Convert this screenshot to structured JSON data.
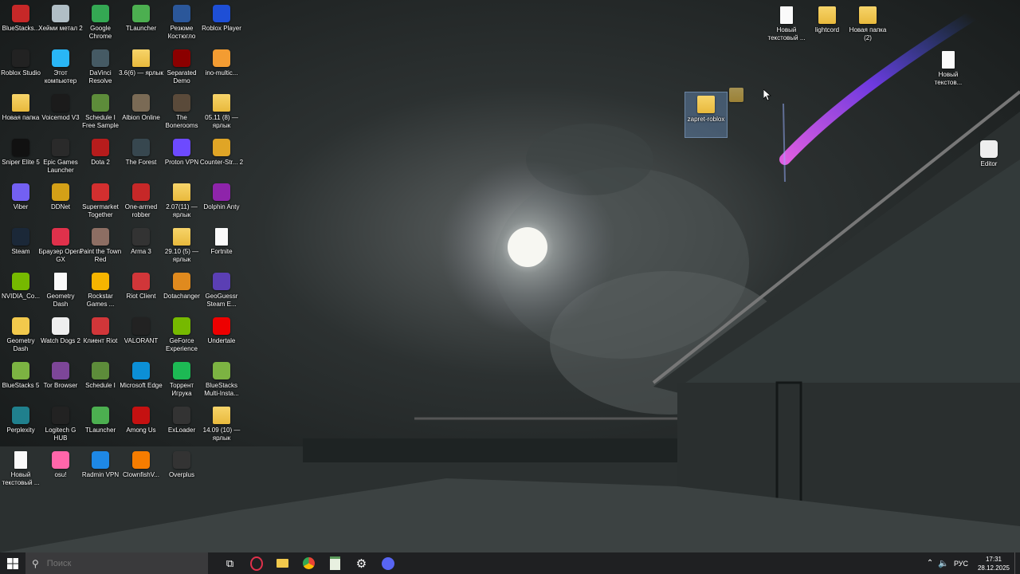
{
  "desktop": {
    "icons": [
      {
        "label": "BlueStacks...",
        "icon": "bluestacks-x-icon",
        "color": "#c62828"
      },
      {
        "label": "Хейми метал 2",
        "icon": "recycle-bin-icon",
        "color": "#b0bec5"
      },
      {
        "label": "Google Chrome",
        "icon": "chrome-icon",
        "color": "#34a853"
      },
      {
        "label": "TLauncher",
        "icon": "tlauncher-icon",
        "color": "#4caf50"
      },
      {
        "label": "Резюме Костюгло",
        "icon": "word-icon",
        "color": "#2b579a"
      },
      {
        "label": "Roblox Player",
        "icon": "roblox-icon",
        "color": "#1e4fd6"
      },
      {
        "label": "Roblox Studio",
        "icon": "roblox-studio-icon",
        "color": "#222"
      },
      {
        "label": "Этот компьютер",
        "icon": "computer-icon",
        "color": "#29b6f6"
      },
      {
        "label": "DaVinci Resolve",
        "icon": "davinci-icon",
        "color": "#455a64"
      },
      {
        "label": "3.6(6) — ярлык",
        "icon": "folder-icon",
        "color": "folder"
      },
      {
        "label": "Separated Demo",
        "icon": "separated-icon",
        "color": "#8b0000"
      },
      {
        "label": "ino-multic...",
        "icon": "inomulti-icon",
        "color": "#f39c32"
      },
      {
        "label": "Новая папка",
        "icon": "folder-icon",
        "color": "folder"
      },
      {
        "label": "Voicemod V3",
        "icon": "voicemod-icon",
        "color": "#1b1b1b"
      },
      {
        "label": "Schedule I Free Sample",
        "icon": "schedule-icon",
        "color": "#5d8c3a"
      },
      {
        "label": "Albion Online",
        "icon": "albion-icon",
        "color": "#7a6a55"
      },
      {
        "label": "The Bonerooms",
        "icon": "bonerooms-icon",
        "color": "#5a4a3a"
      },
      {
        "label": "05.11 (8) — ярлык",
        "icon": "folder-icon",
        "color": "folder"
      },
      {
        "label": "Sniper Elite 5",
        "icon": "sniper-icon",
        "color": "#111"
      },
      {
        "label": "Epic Games Launcher",
        "icon": "epic-icon",
        "color": "#2a2a2a"
      },
      {
        "label": "Dota 2",
        "icon": "dota-icon",
        "color": "#b71c1c"
      },
      {
        "label": "The Forest",
        "icon": "forest-icon",
        "color": "#37474f"
      },
      {
        "label": "Proton VPN",
        "icon": "proton-icon",
        "color": "#6d4aff"
      },
      {
        "label": "Counter-Str... 2",
        "icon": "cs2-icon",
        "color": "#e0a526"
      },
      {
        "label": "Viber",
        "icon": "viber-icon",
        "color": "#7360f2"
      },
      {
        "label": "DDNet",
        "icon": "ddnet-icon",
        "color": "#d4a017"
      },
      {
        "label": "Supermarket Together",
        "icon": "supermarket-icon",
        "color": "#d32f2f"
      },
      {
        "label": "One-armed robber",
        "icon": "robber-icon",
        "color": "#c62828"
      },
      {
        "label": "2.07(11) — ярлык",
        "icon": "folder-icon",
        "color": "folder"
      },
      {
        "label": "Dolphin Anty",
        "icon": "dolphin-icon",
        "color": "#8e24aa"
      },
      {
        "label": "Steam",
        "icon": "steam-icon",
        "color": "#1b2838"
      },
      {
        "label": "Браузер Opera GX",
        "icon": "opera-gx-icon",
        "color": "#e0314b"
      },
      {
        "label": "Paint the Town Red",
        "icon": "paint-town-icon",
        "color": "#8d6e63"
      },
      {
        "label": "Arma 3",
        "icon": "arma-icon",
        "color": "#333"
      },
      {
        "label": "29.10 (5) — ярлык",
        "icon": "folder-icon",
        "color": "folder"
      },
      {
        "label": "Fortnite",
        "icon": "fortnite-icon",
        "color": "doc"
      },
      {
        "label": "NVIDIA_Co...",
        "icon": "nvidia-icon",
        "color": "#76b900"
      },
      {
        "label": "Geometry Dash",
        "icon": "geometry-dash-icon",
        "color": "doc"
      },
      {
        "label": "Rockstar Games ...",
        "icon": "rockstar-icon",
        "color": "#f5b400"
      },
      {
        "label": "Riot Client",
        "icon": "riot-icon",
        "color": "#d13639"
      },
      {
        "label": "Dotachanger",
        "icon": "dotachanger-icon",
        "color": "#e08a1e"
      },
      {
        "label": "GeoGuessr Steam E...",
        "icon": "geoguessr-icon",
        "color": "#5b3fb4"
      },
      {
        "label": "Geometry Dash",
        "icon": "geometry-dash-icon",
        "color": "#f2c94c"
      },
      {
        "label": "Watch Dogs 2",
        "icon": "watchdogs-icon",
        "color": "#eee"
      },
      {
        "label": "Клиент Riot",
        "icon": "riot-icon",
        "color": "#d13639"
      },
      {
        "label": "VALORANT",
        "icon": "valorant-icon",
        "color": "#222"
      },
      {
        "label": "GeForce Experience",
        "icon": "geforce-icon",
        "color": "#76b900"
      },
      {
        "label": "Undertale",
        "icon": "heart-icon",
        "color": "#e00"
      },
      {
        "label": "BlueStacks 5",
        "icon": "bluestacks-icon",
        "color": "#7cb342"
      },
      {
        "label": "Tor Browser",
        "icon": "tor-icon",
        "color": "#7d4698"
      },
      {
        "label": "Schedule I",
        "icon": "schedule-icon",
        "color": "#5d8c3a"
      },
      {
        "label": "Microsoft Edge",
        "icon": "edge-icon",
        "color": "#0c8fd6"
      },
      {
        "label": "Торрент Игрука",
        "icon": "torrent-icon",
        "color": "#1db954"
      },
      {
        "label": "BlueStacks Multi-Insta...",
        "icon": "bluestacks-icon",
        "color": "#7cb342"
      },
      {
        "label": "Perplexity",
        "icon": "perplexity-icon",
        "color": "#20808d"
      },
      {
        "label": "Logitech G HUB",
        "icon": "logitech-icon",
        "color": "#222"
      },
      {
        "label": "TLauncher",
        "icon": "tlauncher-icon",
        "color": "#4caf50"
      },
      {
        "label": "Among Us",
        "icon": "among-us-icon",
        "color": "#c51111"
      },
      {
        "label": "ExLoader",
        "icon": "exloader-icon",
        "color": "#333"
      },
      {
        "label": "14.09 (10) — ярлык",
        "icon": "folder-icon",
        "color": "folder"
      },
      {
        "label": "Новый текстовый ...",
        "icon": "text-file-icon",
        "color": "doc"
      },
      {
        "label": "osu!",
        "icon": "osu-icon",
        "color": "#ff66aa"
      },
      {
        "label": "Radmin VPN",
        "icon": "radmin-icon",
        "color": "#1e88e5"
      },
      {
        "label": "ClownfishV...",
        "icon": "clownfish-icon",
        "color": "#f57c00"
      },
      {
        "label": "Overplus",
        "icon": "overplus-icon",
        "color": "#333"
      }
    ],
    "right_icons": [
      {
        "label": "Новый текстовый ...",
        "icon": "text-file-icon",
        "color": "doc"
      },
      {
        "label": "lightcord",
        "icon": "folder-icon",
        "color": "folder"
      },
      {
        "label": "Новая папка (2)",
        "icon": "folder-icon",
        "color": "folder"
      },
      {
        "label": "Новый текстов...",
        "icon": "text-file-icon",
        "color": "doc"
      },
      {
        "label": "zapret-roblox",
        "icon": "zip-folder-icon",
        "color": "folder"
      },
      {
        "label": "Editor",
        "icon": "editor-icon",
        "color": "#eee"
      }
    ],
    "drag_label": "zapret-roblox"
  },
  "taskbar": {
    "search_placeholder": "Поиск",
    "apps": [
      "task-view-icon",
      "opera-gx-icon",
      "file-explorer-icon",
      "chrome-icon",
      "notepad-icon",
      "settings-icon",
      "discord-icon"
    ],
    "language": "РУС",
    "time": "17:31",
    "date": "28.12.2025"
  }
}
